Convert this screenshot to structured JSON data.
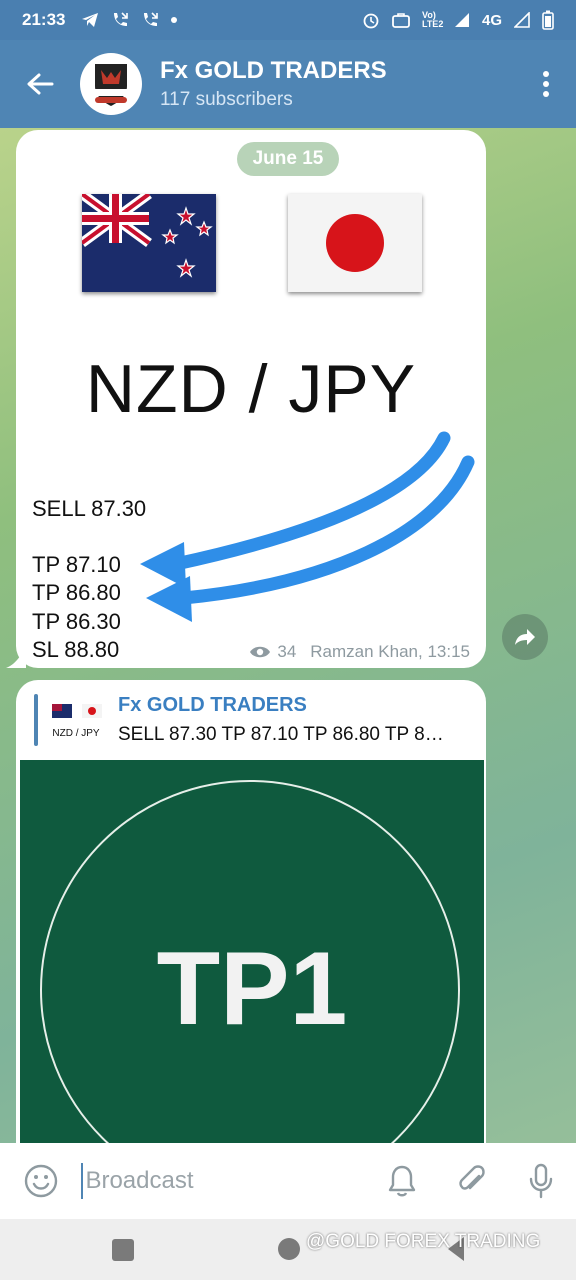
{
  "status_bar": {
    "time": "21:33",
    "network": "4G",
    "volte": "Vo) LTE2"
  },
  "header": {
    "channel_name": "Fx GOLD TRADERS",
    "subscribers": "117 subscribers",
    "avatar_logo_text": "FX-GOLD (TRADERS)"
  },
  "message1": {
    "date": "June 15",
    "pair": "NZD / JPY",
    "signals": [
      "SELL 87.30",
      "TP 87.10",
      "TP 86.80",
      "TP 86.30",
      "SL 88.80"
    ],
    "views": "34",
    "author_time": "Ramzan Khan, 13:15"
  },
  "message2": {
    "reply_name": "Fx GOLD TRADERS",
    "reply_thumb_label": "NZD / JPY",
    "reply_text": "SELL 87.30  TP 87.10 TP 86.80 TP 8…",
    "image_text": "TP1"
  },
  "composer": {
    "placeholder": "Broadcast"
  },
  "watermark": "@GOLD FOREX TRADING",
  "colors": {
    "header": "#4f85b4",
    "arrow": "#2f8ee8",
    "tp_background": "#0f5a3e"
  }
}
